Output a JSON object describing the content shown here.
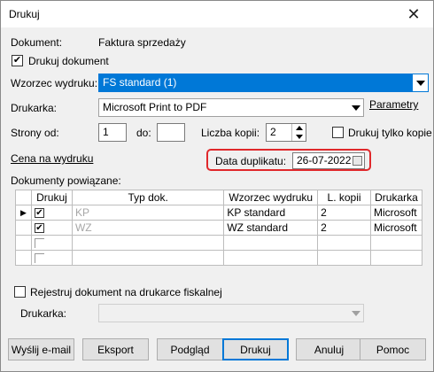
{
  "window": {
    "title": "Drukuj"
  },
  "document": {
    "label": "Dokument:",
    "value": "Faktura sprzedaży"
  },
  "print_document": {
    "label": "Drukuj dokument",
    "checked": true
  },
  "template": {
    "label": "Wzorzec wydruku:",
    "value": "FS standard (1)"
  },
  "printer": {
    "label": "Drukarka:",
    "value": "Microsoft Print to PDF",
    "params_link": "Parametry"
  },
  "pages": {
    "label_from": "Strony od:",
    "from_value": "1",
    "label_to": "do:",
    "to_value": ""
  },
  "copies": {
    "label": "Liczba kopii:",
    "value": "2"
  },
  "print_copies_only": {
    "label": "Drukuj tylko kopie",
    "checked": false
  },
  "price_link": "Cena na wydruku",
  "duplicate_date": {
    "label": "Data duplikatu:",
    "value": "26-07-2022"
  },
  "related": {
    "label": "Dokumenty powiązane:",
    "columns": [
      "Drukuj",
      "Typ dok.",
      "Wzorzec wydruku",
      "L. kopii",
      "Drukarka"
    ],
    "rows": [
      {
        "current": true,
        "print": true,
        "type": "KP",
        "template": "KP standard",
        "copies": "2",
        "printer": "Microsoft"
      },
      {
        "current": false,
        "print": true,
        "type": "WZ",
        "template": "WZ standard",
        "copies": "2",
        "printer": "Microsoft"
      },
      {
        "current": false,
        "print": false,
        "type": "",
        "template": "",
        "copies": "",
        "printer": ""
      },
      {
        "current": false,
        "print": false,
        "type": "",
        "template": "",
        "copies": "",
        "printer": ""
      }
    ]
  },
  "fiscal": {
    "label": "Rejestruj dokument na drukarce fiskalnej",
    "checked": false,
    "printer_label": "Drukarka:",
    "printer_value": ""
  },
  "buttons": {
    "email": "Wyślij e-mail",
    "export": "Eksport",
    "preview": "Podgląd",
    "print": "Drukuj",
    "cancel": "Anuluj",
    "help": "Pomoc"
  },
  "colors": {
    "selection": "#0078d7",
    "highlight": "#e0282b"
  }
}
